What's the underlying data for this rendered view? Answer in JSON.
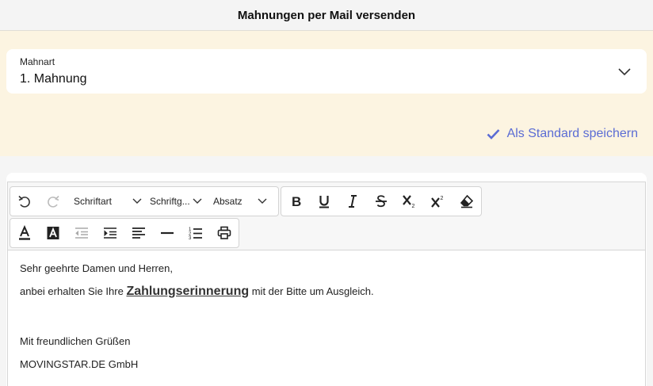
{
  "header": {
    "title": "Mahnungen per Mail versenden"
  },
  "mahnart": {
    "label": "Mahnart",
    "value": "1. Mahnung"
  },
  "save_default": {
    "label": "Als Standard speichern"
  },
  "toolbar": {
    "font_family": "Schriftart",
    "font_size": "Schriftg...",
    "paragraph": "Absatz"
  },
  "editor": {
    "greeting": "Sehr geehrte Damen und Herren,",
    "line2_pre": "anbei erhalten Sie Ihre ",
    "line2_highlight": "Zahlungserinnerung",
    "line2_post": " mit der Bitte um Ausgleich.",
    "closing": "Mit freundlichen Grüßen",
    "company": "MOVINGSTAR.DE GmbH"
  },
  "colors": {
    "accent": "#5b6cd4",
    "yellow_panel": "#fcf4e1"
  }
}
